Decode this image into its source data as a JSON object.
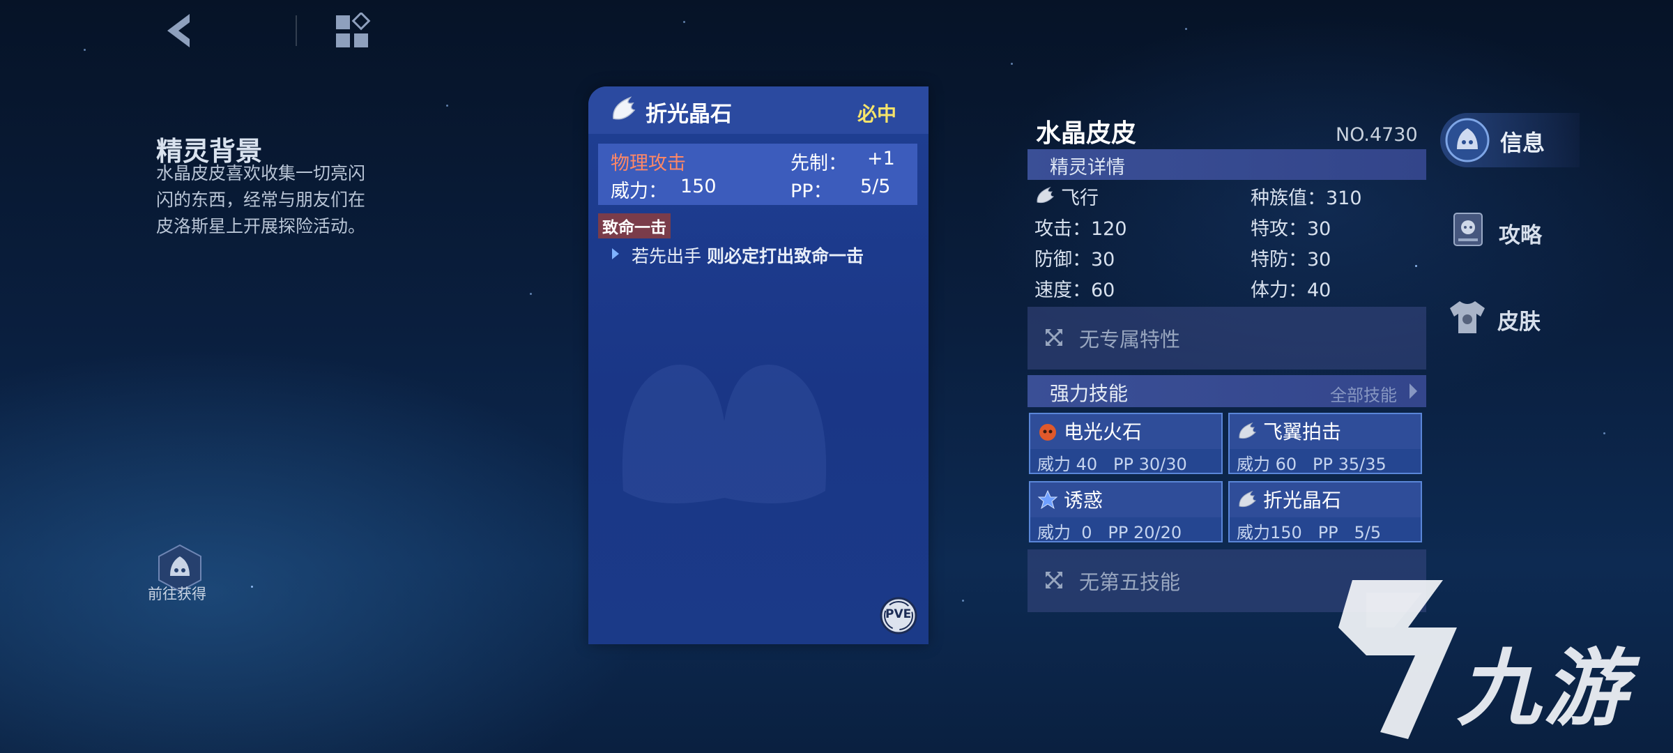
{
  "top": {
    "back_icon": "chevron-left-icon",
    "menu_icon": "grid-menu-icon"
  },
  "background": {
    "title": "精灵背景",
    "text": "水晶皮皮喜欢收集一切亮闪闪的东西，经常与朋友们在皮洛斯星上开展探险活动。"
  },
  "obtain": {
    "label": "前往获得",
    "icon": "flame-mascot-icon"
  },
  "skill_card": {
    "name": "折光晶石",
    "hit": "必中",
    "category": "物理攻击",
    "priority_label": "先制：",
    "priority_value": "+1",
    "power_label": "威力：",
    "power_value": "150",
    "pp_label": "PP：",
    "pp_value": "5/5",
    "tag": "致命一击",
    "effect_prefix": "若先出手",
    "effect_bold": "则必定打出致命一击",
    "pve_label": "PVE",
    "type_icon": "wing-icon",
    "color_card": "#1f3f93",
    "color_hit": "#f7e46a",
    "color_category": "#ff8766"
  },
  "pet": {
    "name": "水晶皮皮",
    "number": "NO.4730",
    "section": "精灵详情",
    "type": "飞行",
    "total_stat": "种族值：310",
    "attack": "攻击：120",
    "sp_attack": "特攻：30",
    "defense": "防御：30",
    "sp_defense": "特防：30",
    "speed": "速度：60",
    "hp": "体力：40",
    "trait": "无专属特性",
    "strong_skills": "强力技能",
    "all_skills": "全部技能",
    "fifth_skill": "无第五技能"
  },
  "skills": [
    {
      "name": "电光火石",
      "stat": "威力 40   PP 30/30",
      "icon": "fire-type-icon"
    },
    {
      "name": "飞翼拍击",
      "stat": "威力 60   PP 35/35",
      "icon": "wing-icon"
    },
    {
      "name": "诱惑",
      "stat": "威力  0   PP 20/20",
      "icon": "star-type-icon"
    },
    {
      "name": "折光晶石",
      "stat": "威力150   PP   5/5",
      "icon": "wing-icon"
    }
  ],
  "nav": {
    "info": "信息",
    "guide": "攻略",
    "skin": "皮肤"
  },
  "watermark": {
    "text": "九游"
  }
}
